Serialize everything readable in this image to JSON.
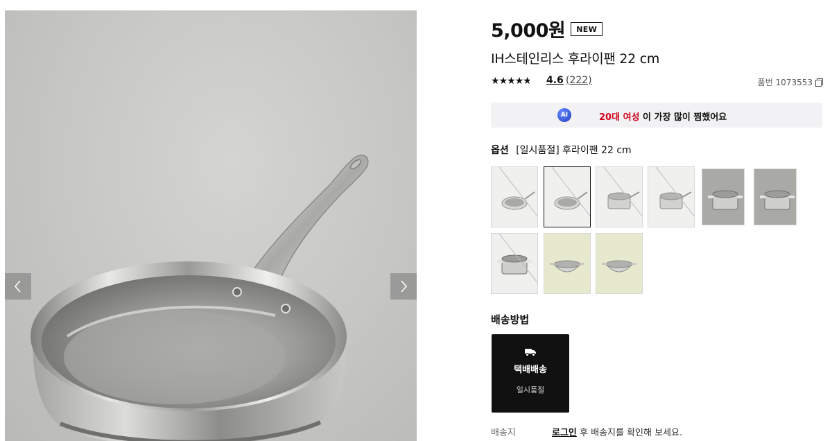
{
  "product": {
    "price": "5,000원",
    "badge": "NEW",
    "title": "IH스테인리스 후라이팬 22 cm",
    "rating": {
      "score": "4.6",
      "count": "(222)",
      "stars": 4.6
    },
    "product_number": "품번 1073553"
  },
  "ai_banner": {
    "icon": "AI",
    "highlight": "20대 여성",
    "text": " 이 가장 많이 찜했어요"
  },
  "option": {
    "label": "옵션",
    "value": "[일시품절] 후라이팬 22 cm",
    "swatches": [
      {
        "kind": "pan",
        "soldout": true,
        "selected": false,
        "bg": "light"
      },
      {
        "kind": "pan",
        "soldout": true,
        "selected": true,
        "bg": "light"
      },
      {
        "kind": "pot",
        "soldout": true,
        "selected": false,
        "bg": "light"
      },
      {
        "kind": "pot",
        "soldout": true,
        "selected": false,
        "bg": "light"
      },
      {
        "kind": "pot-handles",
        "soldout": false,
        "selected": false,
        "bg": "gray"
      },
      {
        "kind": "pot-handles",
        "soldout": false,
        "selected": false,
        "bg": "gray"
      },
      {
        "kind": "pot-handles",
        "soldout": true,
        "selected": false,
        "bg": "light"
      },
      {
        "kind": "wok",
        "soldout": false,
        "selected": false,
        "bg": "green"
      },
      {
        "kind": "wok",
        "soldout": false,
        "selected": false,
        "bg": "green"
      }
    ]
  },
  "shipping": {
    "heading": "배송방법",
    "method": "택배배송",
    "status": "일시품절",
    "icon": "truck-icon"
  },
  "destination": {
    "label": "배송지",
    "login": "로그인",
    "text": " 후 배송지를 확인해 보세요."
  },
  "colors": {
    "accent_red": "#d0021b",
    "dark": "#111111",
    "banner_bg": "#f2f2f4"
  }
}
